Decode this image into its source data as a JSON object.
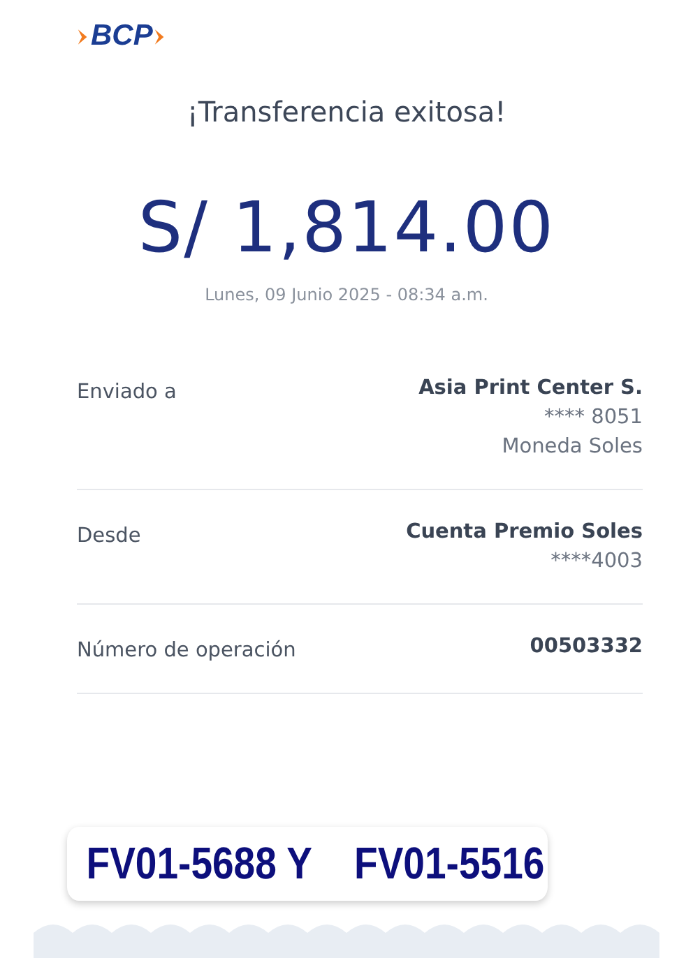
{
  "logo": {
    "text": "BCP"
  },
  "title": "¡Transferencia exitosa!",
  "amount": "S/ 1,814.00",
  "date": "Lunes, 09 Junio 2025 - 08:34 a.m.",
  "details": [
    {
      "label": "Enviado a",
      "lines": [
        "Asia Print Center S.",
        "**** 8051",
        "Moneda Soles"
      ]
    },
    {
      "label": "Desde",
      "lines": [
        "Cuenta Premio Soles",
        "****4003"
      ]
    },
    {
      "label": "Número de operación",
      "lines": [
        "00503332"
      ]
    }
  ],
  "note": "FV01-5688 Y    FV01-5516"
}
